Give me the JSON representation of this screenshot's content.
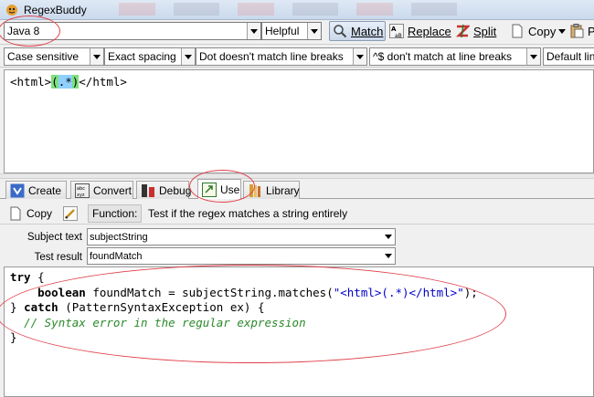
{
  "window": {
    "title": "RegexBuddy"
  },
  "toolbar": {
    "flavor": "Java 8",
    "help_mode": "Helpful",
    "match_label": "Match",
    "replace_label": "Replace",
    "split_label": "Split",
    "copy_label": "Copy",
    "paste_label": "P"
  },
  "options": [
    {
      "label": "Case sensitive"
    },
    {
      "label": "Exact spacing"
    },
    {
      "label": "Dot doesn't match line breaks"
    },
    {
      "label": "^$ don't match at line breaks"
    },
    {
      "label": "Default lin"
    }
  ],
  "regex": {
    "prefix": "<html>",
    "group_open": "(",
    "dotstar": ".*",
    "group_close": ")",
    "suffix": "</html>"
  },
  "tabs": [
    {
      "label": "Create"
    },
    {
      "label": "Convert"
    },
    {
      "label": "Debug"
    },
    {
      "label": "Use"
    },
    {
      "label": "Library"
    }
  ],
  "use": {
    "copy_label": "Copy",
    "function_label": "Function:",
    "function_value": "Test if the regex matches a string entirely",
    "subject_label": "Subject text",
    "subject_value": "subjectString",
    "result_label": "Test result",
    "result_value": "foundMatch"
  },
  "code": {
    "l1_kw": "try",
    "l1_rest": " {",
    "l2_indent": "    ",
    "l2_kw": "boolean",
    "l2_mid": " foundMatch = subjectString.matches(",
    "l2_str": "\"<html>(.*)</html>\"",
    "l2_end": ");",
    "l3_open": "} ",
    "l3_kw": "catch",
    "l3_rest": " (PatternSyntaxException ex) {",
    "l4_indent": "  ",
    "l4_cmt": "// Syntax error in the regular expression",
    "l5": "}"
  },
  "colors": {
    "annotation": "#e0404a",
    "group_bg": "#7ee07e",
    "dotstar_bg": "#8fd0ff"
  }
}
